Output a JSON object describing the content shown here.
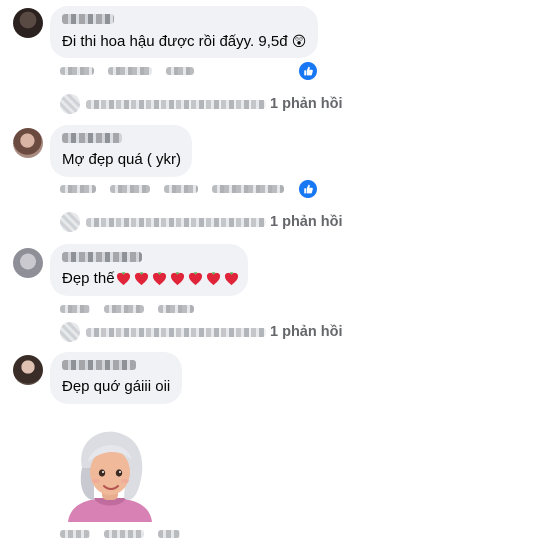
{
  "comments": [
    {
      "text": "Đi thi hoa hậu được rồi đấyy. 9,5đ",
      "emoji": "😲",
      "reply_count": "1 phản hồi",
      "has_like": true
    },
    {
      "text": "Mợ đẹp quá ( ykr)",
      "reply_count": "1 phản hồi",
      "has_like": true
    },
    {
      "text": "Đẹp thế",
      "reply_count": "1 phản hồi",
      "has_like": false
    },
    {
      "text": "Đẹp quớ gáiii oii",
      "has_like": false
    }
  ],
  "colors": {
    "bubble": "#f0f2f5",
    "like_blue": "#1877f2",
    "secondary_text": "#65676b",
    "heart_red": "#e0243a"
  },
  "icons": {
    "like": "thumbs-up-icon",
    "heart": "strawberry-heart-icon",
    "emoji": "astonished-face-emoji"
  }
}
